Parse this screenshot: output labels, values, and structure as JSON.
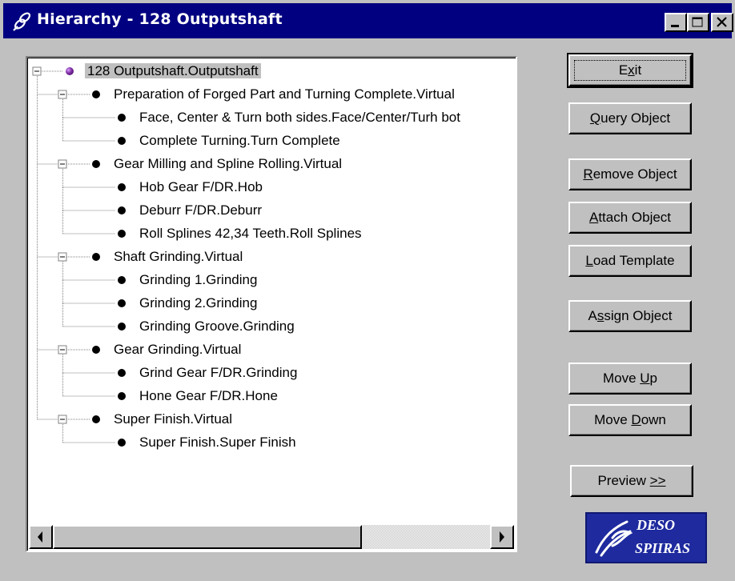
{
  "window": {
    "title": "Hierarchy - 128 Outputshaft",
    "icon": "link-icon",
    "controls": [
      "minimize-icon",
      "maximize-icon",
      "close-icon"
    ]
  },
  "tree": {
    "nodes": [
      {
        "label": "128 Outputshaft.Outputshaft",
        "level": 0,
        "expander": "minus",
        "root": true,
        "selected": true
      },
      {
        "label": "Preparation of Forged Part and Turning Complete.Virtual",
        "level": 1,
        "expander": "minus"
      },
      {
        "label": "Face, Center & Turn both sides.Face/Center/Turh bot",
        "level": 2
      },
      {
        "label": "Complete Turning.Turn Complete",
        "level": 2
      },
      {
        "label": "Gear Milling and Spline Rolling.Virtual",
        "level": 1,
        "expander": "minus"
      },
      {
        "label": "Hob Gear F/DR.Hob",
        "level": 2
      },
      {
        "label": "Deburr F/DR.Deburr",
        "level": 2
      },
      {
        "label": "Roll Splines 42,34 Teeth.Roll Splines",
        "level": 2
      },
      {
        "label": "Shaft Grinding.Virtual",
        "level": 1,
        "expander": "minus"
      },
      {
        "label": "Grinding 1.Grinding",
        "level": 2
      },
      {
        "label": "Grinding 2.Grinding",
        "level": 2
      },
      {
        "label": "Grinding Groove.Grinding",
        "level": 2
      },
      {
        "label": "Gear Grinding.Virtual",
        "level": 1,
        "expander": "minus"
      },
      {
        "label": "Grind Gear F/DR.Grinding",
        "level": 2
      },
      {
        "label": "Hone Gear F/DR.Hone",
        "level": 2
      },
      {
        "label": "Super Finish.Virtual",
        "level": 1,
        "expander": "minus"
      },
      {
        "label": "Super Finish.Super Finish",
        "level": 2
      }
    ]
  },
  "buttons": {
    "exit": {
      "pre": "E",
      "ul": "x",
      "post": "it"
    },
    "query": {
      "pre": "",
      "ul": "Q",
      "post": "uery Object"
    },
    "remove": {
      "pre": "",
      "ul": "R",
      "post": "emove Object"
    },
    "attach": {
      "pre": "",
      "ul": "A",
      "post": "ttach Object"
    },
    "load": {
      "pre": "",
      "ul": "L",
      "post": "oad Template"
    },
    "assign": {
      "pre": "A",
      "ul": "s",
      "post": "sign Object"
    },
    "move_up": {
      "pre": "Move ",
      "ul": "U",
      "post": "p"
    },
    "move_down": {
      "pre": "Move ",
      "ul": "D",
      "post": "own"
    },
    "preview": {
      "pre": "Preview ",
      "ul": ">>",
      "post": ""
    }
  },
  "logo": {
    "line1": "DESO",
    "line2": "SPIIRAS"
  },
  "colors": {
    "titlebar": "#000080",
    "face": "#c0c0c0",
    "logo_bg": "#1e2a9e"
  }
}
